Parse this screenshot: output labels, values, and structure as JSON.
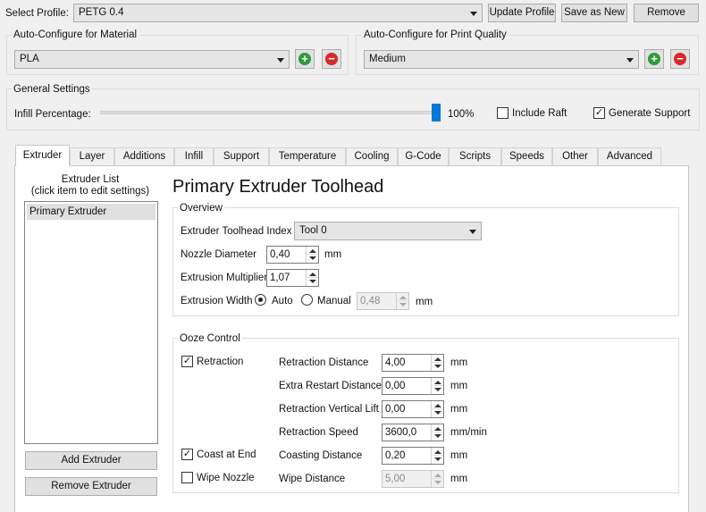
{
  "profile": {
    "label": "Select Profile:",
    "value": "PETG 0.4",
    "update_label": "Update Profile",
    "save_new_label": "Save as New",
    "remove_label": "Remove"
  },
  "material": {
    "title": "Auto-Configure for Material",
    "value": "PLA"
  },
  "quality": {
    "title": "Auto-Configure for Print Quality",
    "value": "Medium"
  },
  "general": {
    "title": "General Settings",
    "infill_label": "Infill Percentage:",
    "infill_percent": 100,
    "infill_text": "100%",
    "raft_label": "Include Raft",
    "raft_checked": false,
    "support_label": "Generate Support",
    "support_checked": true
  },
  "tabs": [
    "Extruder",
    "Layer",
    "Additions",
    "Infill",
    "Support",
    "Temperature",
    "Cooling",
    "G-Code",
    "Scripts",
    "Speeds",
    "Other",
    "Advanced"
  ],
  "active_tab": "Extruder",
  "extruder_list": {
    "title_line1": "Extruder List",
    "title_line2": "(click item to edit settings)",
    "items": [
      "Primary Extruder"
    ],
    "add_label": "Add Extruder",
    "remove_label": "Remove Extruder"
  },
  "heading": "Primary Extruder Toolhead",
  "overview": {
    "title": "Overview",
    "toolhead_label": "Extruder Toolhead Index",
    "toolhead_value": "Tool 0",
    "nozzle_label": "Nozzle Diameter",
    "nozzle_value": "0,40",
    "nozzle_unit": "mm",
    "multiplier_label": "Extrusion Multiplier",
    "multiplier_value": "1,07",
    "width_label": "Extrusion Width",
    "auto_label": "Auto",
    "manual_label": "Manual",
    "width_mode": "Auto",
    "width_value": "0,48",
    "width_unit": "mm"
  },
  "ooze": {
    "title": "Ooze Control",
    "retraction_label": "Retraction",
    "retraction_checked": true,
    "coast_label": "Coast at End",
    "coast_checked": true,
    "wipe_label": "Wipe Nozzle",
    "wipe_checked": false,
    "rows": [
      {
        "label": "Retraction Distance",
        "value": "4,00",
        "unit": "mm",
        "enabled": true
      },
      {
        "label": "Extra Restart Distance",
        "value": "0,00",
        "unit": "mm",
        "enabled": true
      },
      {
        "label": "Retraction Vertical Lift",
        "value": "0,00",
        "unit": "mm",
        "enabled": true
      },
      {
        "label": "Retraction Speed",
        "value": "3600,0",
        "unit": "mm/min",
        "enabled": true
      },
      {
        "label": "Coasting Distance",
        "value": "0,20",
        "unit": "mm",
        "enabled": true
      },
      {
        "label": "Wipe Distance",
        "value": "5,00",
        "unit": "mm",
        "enabled": false
      }
    ]
  },
  "colors": {
    "add_icon": "#2e9b3a",
    "remove_icon": "#d42a2a",
    "slider_handle": "#0078d7",
    "selected_item": "#e0e0e0"
  }
}
